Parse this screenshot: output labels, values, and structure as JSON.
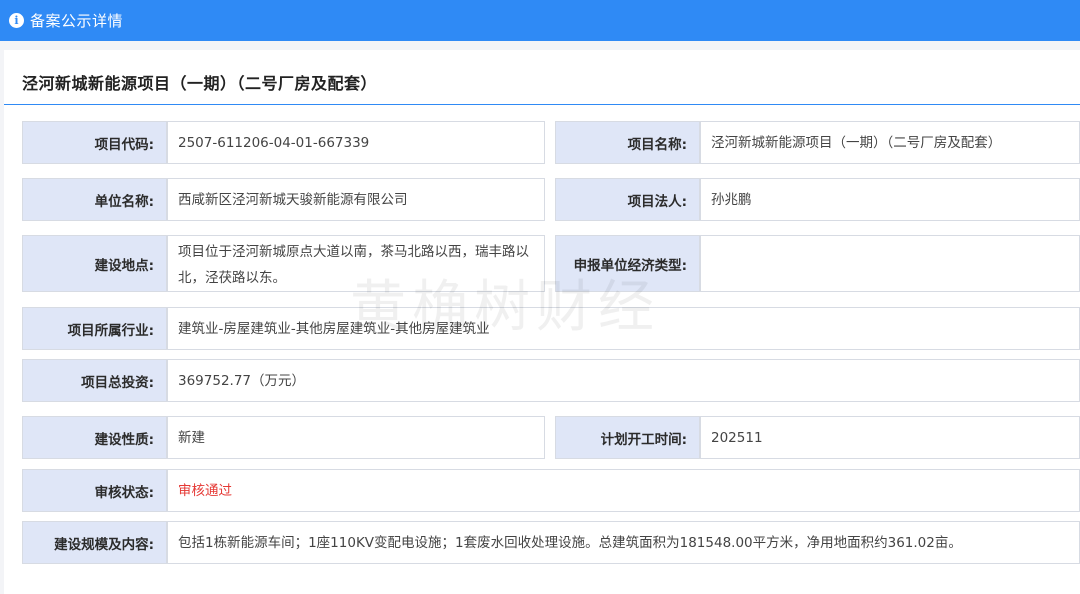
{
  "header": {
    "title": "备案公示详情",
    "icon": "info-icon"
  },
  "project": {
    "title": "泾河新城新能源项目（一期）（二号厂房及配套）"
  },
  "watermark": "黄桷树财经",
  "colors": {
    "accent": "#2f8af5",
    "label_bg": "#dfe6f7",
    "status_pass": "#e53935"
  },
  "fields": {
    "project_code": {
      "label": "项目代码:",
      "value": "2507-611206-04-01-667339"
    },
    "project_name": {
      "label": "项目名称:",
      "value": "泾河新城新能源项目（一期）（二号厂房及配套）"
    },
    "unit_name": {
      "label": "单位名称:",
      "value": "西咸新区泾河新城天骏新能源有限公司"
    },
    "legal_person": {
      "label": "项目法人:",
      "value": "孙兆鹏"
    },
    "location": {
      "label": "建设地点:",
      "value": "项目位于泾河新城原点大道以南，茶马北路以西，瑞丰路以北，泾茯路以东。"
    },
    "economic_type": {
      "label": "申报单位经济类型:",
      "value": ""
    },
    "industry": {
      "label": "项目所属行业:",
      "value": "建筑业-房屋建筑业-其他房屋建筑业-其他房屋建筑业"
    },
    "investment": {
      "label": "项目总投资:",
      "value": "369752.77（万元）"
    },
    "nature": {
      "label": "建设性质:",
      "value": "新建"
    },
    "start_time": {
      "label": "计划开工时间:",
      "value": "202511"
    },
    "review_status": {
      "label": "审核状态:",
      "value": "审核通过"
    },
    "scale": {
      "label": "建设规模及内容:",
      "value": "包括1栋新能源车间；1座110KV变配电设施；1套废水回收处理设施。总建筑面积为181548.00平方米，净用地面积约361.02亩。"
    }
  }
}
